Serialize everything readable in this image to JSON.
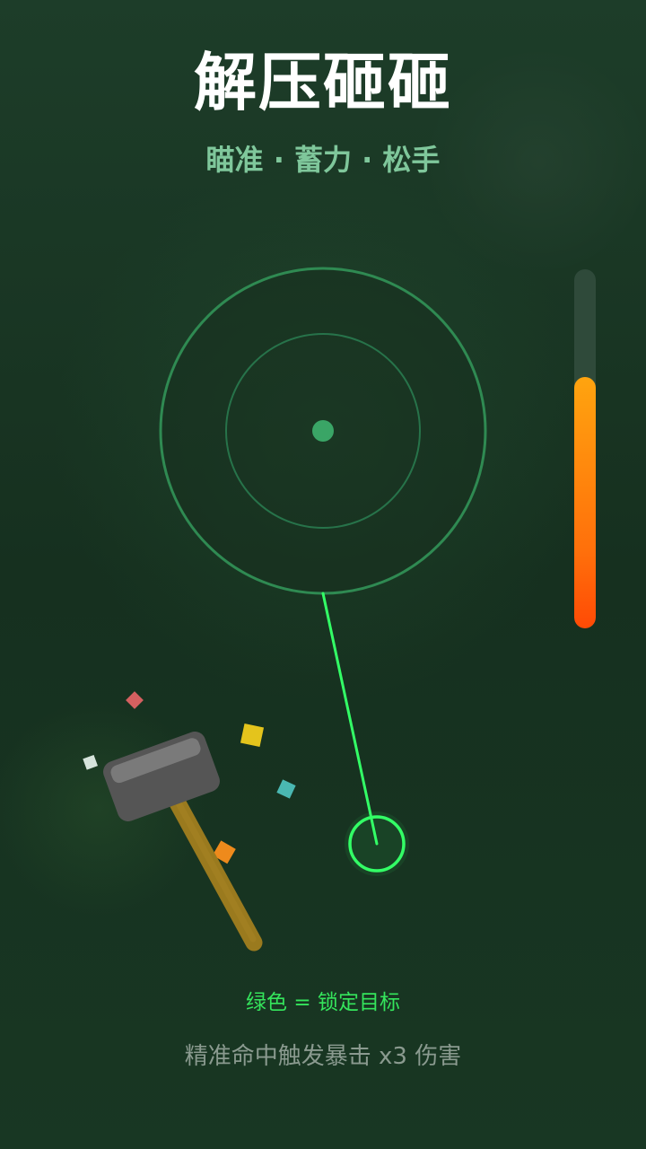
{
  "header": {
    "title": "解压砸砸",
    "subtitle": "瞄准 · 蓄力 · 松手"
  },
  "power_meter": {
    "level": 0.7
  },
  "hints": {
    "lock_hint": "绿色 = 锁定目标",
    "crit_hint": "精准命中触发暴击 x3 伤害"
  },
  "colors": {
    "background": "#173522",
    "target_ring": "#2f8a52",
    "aim_line": "#33ff66",
    "power_top": "#ffa40f",
    "power_bottom": "#ff4a05",
    "hammer_head": "#5a5a5a",
    "hammer_handle": "#9a7a1e"
  },
  "icons": {
    "target": "target-icon",
    "cursor": "aim-cursor-icon",
    "hammer": "hammer-icon"
  }
}
